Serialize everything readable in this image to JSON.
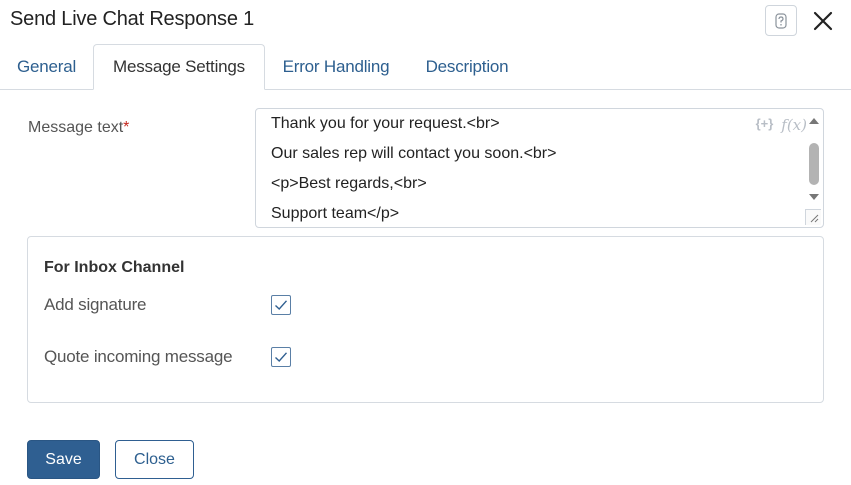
{
  "dialog": {
    "title": "Send Live Chat Response 1",
    "help_label": "?",
    "close_label": "×"
  },
  "tabs": [
    {
      "label": "General",
      "active": false
    },
    {
      "label": "Message Settings",
      "active": true
    },
    {
      "label": "Error Handling",
      "active": false
    },
    {
      "label": "Description",
      "active": false
    }
  ],
  "message": {
    "label": "Message text",
    "required_mark": "*",
    "lines": [
      "Thank you for your request.<br>",
      "Our sales rep will contact you soon.<br>",
      "<p>Best regards,<br>",
      "Support team</p>"
    ],
    "tool_insert": "{+}",
    "tool_function": "f(x)"
  },
  "inbox": {
    "title": "For Inbox Channel",
    "options": [
      {
        "label": "Add signature",
        "checked": true
      },
      {
        "label": "Quote incoming message",
        "checked": true
      }
    ]
  },
  "footer": {
    "save_label": "Save",
    "close_label": "Close"
  },
  "colors": {
    "accent": "#2f5f91",
    "tab_text": "#2d5f8f",
    "required": "#c4261d"
  }
}
